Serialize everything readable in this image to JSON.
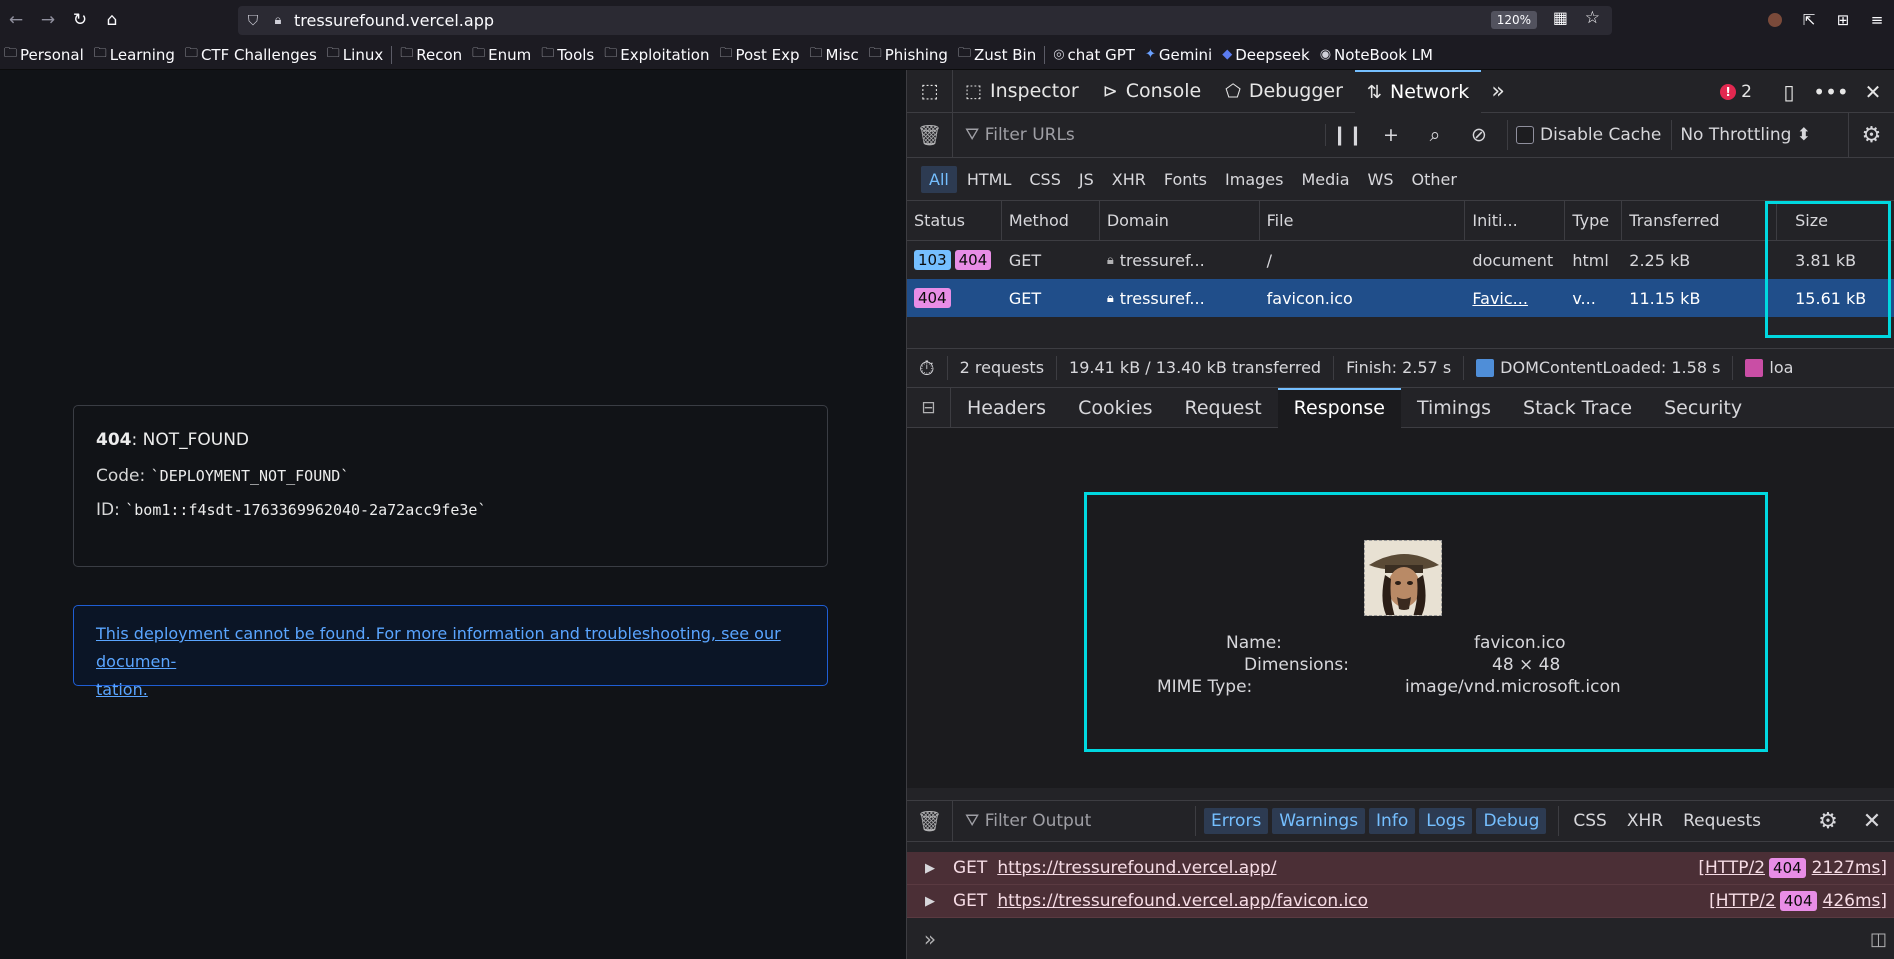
{
  "browser": {
    "url": "tressurefound.vercel.app",
    "zoom": "120%",
    "bookmarks": [
      {
        "label": "Personal"
      },
      {
        "label": "Learning"
      },
      {
        "label": "CTF Challenges"
      },
      {
        "label": "Linux"
      },
      {
        "label": "Recon"
      },
      {
        "label": "Enum"
      },
      {
        "label": "Tools"
      },
      {
        "label": "Exploitation"
      },
      {
        "label": "Post Exp"
      },
      {
        "label": "Misc"
      },
      {
        "label": "Phishing"
      },
      {
        "label": "Zust Bin"
      },
      {
        "label": "chat GPT"
      },
      {
        "label": "Gemini"
      },
      {
        "label": "Deepseek"
      },
      {
        "label": "NoteBook LM"
      }
    ]
  },
  "page": {
    "error_code": "404",
    "error_name": ": NOT_FOUND",
    "code_label": "Code: ",
    "code_value": "`DEPLOYMENT_NOT_FOUND`",
    "id_label": "ID: ",
    "id_value": "`bom1::f4sdt-1763369962040-2a72acc9fe3e`",
    "info_line1": "This deployment cannot be found. For more information and troubleshooting, see our documen-",
    "info_line2": "tation."
  },
  "devtools": {
    "tools": {
      "inspector": "Inspector",
      "console": "Console",
      "debugger": "Debugger",
      "network": "Network"
    },
    "error_count": "2",
    "filter_urls_placeholder": "Filter URLs",
    "disable_cache": "Disable Cache",
    "throttling": "No Throttling",
    "type_filters": [
      "All",
      "HTML",
      "CSS",
      "JS",
      "XHR",
      "Fonts",
      "Images",
      "Media",
      "WS",
      "Other"
    ],
    "columns": {
      "status": "Status",
      "method": "Method",
      "domain": "Domain",
      "file": "File",
      "initiator": "Initi...",
      "type": "Type",
      "transferred": "Transferred",
      "size": "Size"
    },
    "requests": [
      {
        "status1": "103",
        "status2": "404",
        "method": "GET",
        "domain": "tressuref...",
        "file": "/",
        "initiator": "document",
        "type": "html",
        "transferred": "2.25 kB",
        "size": "3.81 kB"
      },
      {
        "status1": "404",
        "method": "GET",
        "domain": "tressuref...",
        "file": "favicon.ico",
        "initiator": "Favic...",
        "type": "v...",
        "transferred": "11.15 kB",
        "size": "15.61 kB"
      }
    ],
    "summary": {
      "requests": "2 requests",
      "transferred": "19.41 kB / 13.40 kB transferred",
      "finish": "Finish: 2.57 s",
      "dcl": "DOMContentLoaded: 1.58 s",
      "load": "loa",
      "dcl_color": "#4f8ed8",
      "load_color": "#c94ea5"
    },
    "detail_tabs": [
      "Headers",
      "Cookies",
      "Request",
      "Response",
      "Timings",
      "Stack Trace",
      "Security"
    ],
    "preview": {
      "name_label": "Name:",
      "name_value": "favicon.ico",
      "dim_label": "Dimensions:",
      "dim_value": "48 × 48",
      "mime_label": "MIME Type:",
      "mime_value": "image/vnd.microsoft.icon"
    },
    "console": {
      "filter_placeholder": "Filter Output",
      "levels": [
        "Errors",
        "Warnings",
        "Info",
        "Logs",
        "Debug"
      ],
      "categories": [
        "CSS",
        "XHR",
        "Requests"
      ],
      "logs": [
        {
          "method": "GET",
          "url": "https://tressurefound.vercel.app/",
          "proto": "[HTTP/2",
          "status": "404",
          "time": "2127ms]"
        },
        {
          "method": "GET",
          "url": "https://tressurefound.vercel.app/favicon.ico",
          "proto": "[HTTP/2",
          "status": "404",
          "time": "426ms]"
        }
      ]
    }
  }
}
